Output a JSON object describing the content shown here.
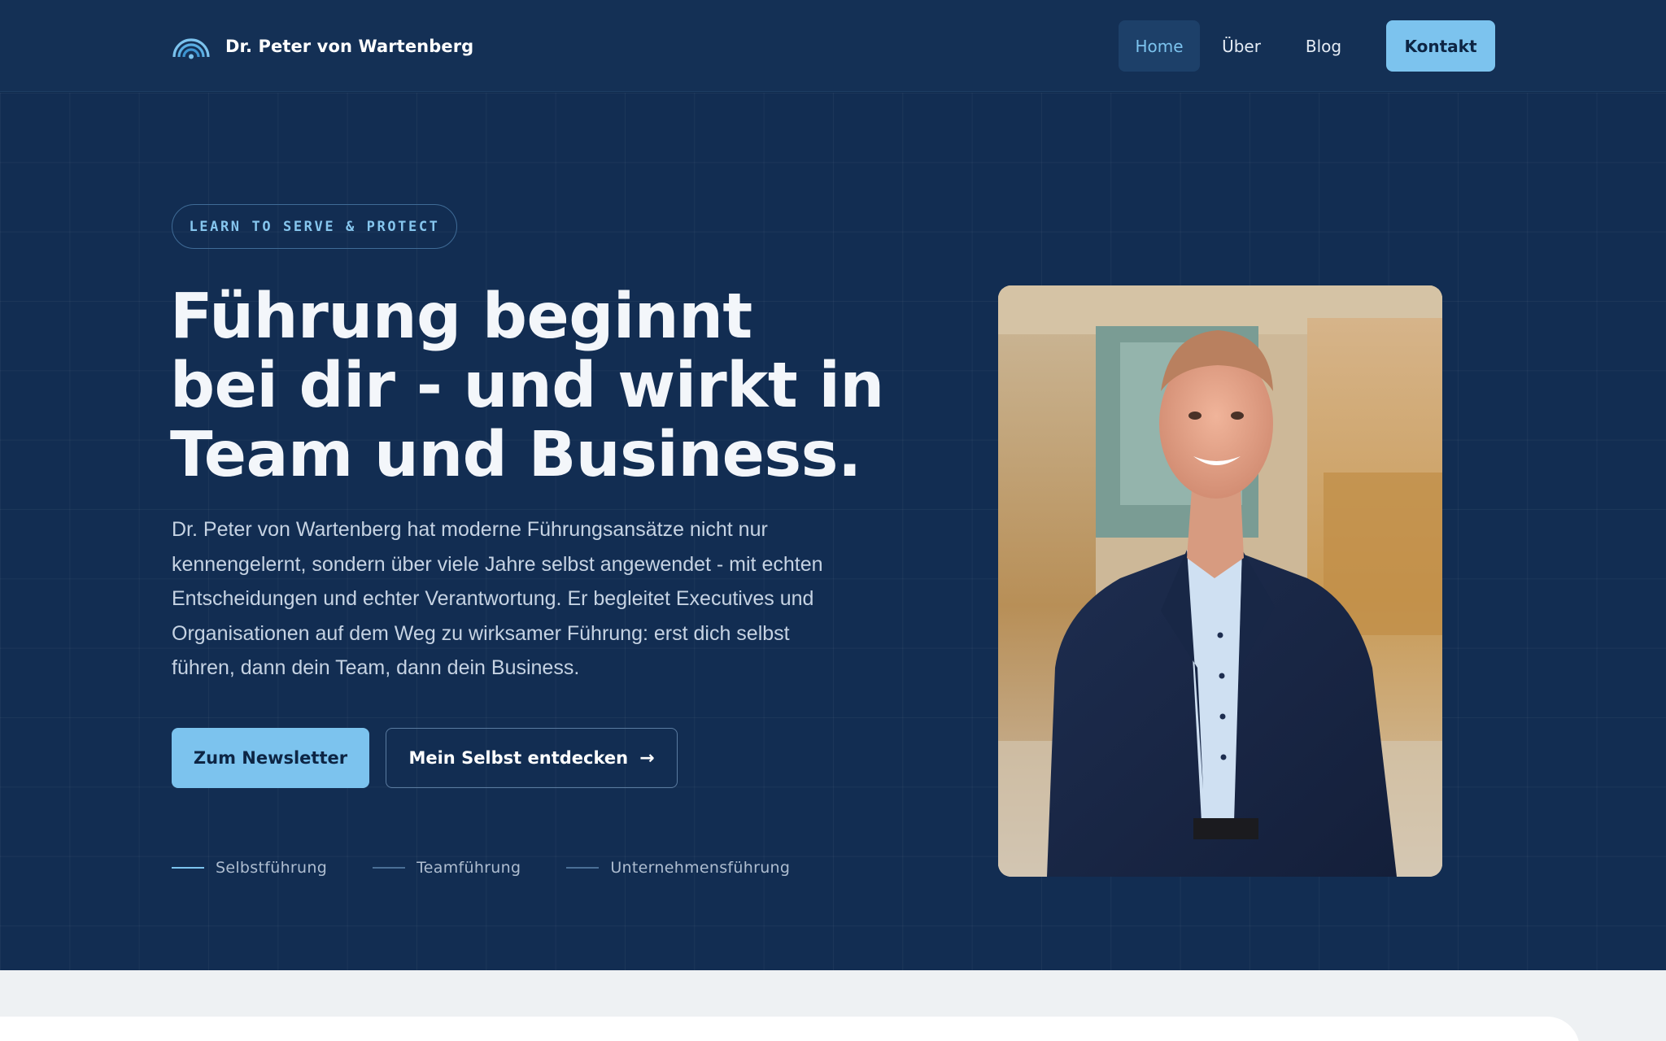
{
  "header": {
    "brand_name": "Dr. Peter von Wartenberg",
    "logo_icon": "rainbow-arc-logo-icon",
    "nav": [
      {
        "label": "Home",
        "active": true
      },
      {
        "label": "Über",
        "active": false
      },
      {
        "label": "Blog",
        "active": false
      }
    ],
    "cta_label": "Kontakt"
  },
  "hero": {
    "badge": "LEARN TO SERVE & PROTECT",
    "headline_lines": [
      "Führung beginnt",
      "bei dir - und wirkt in",
      "Team und Business."
    ],
    "intro": "Dr. Peter von Wartenberg hat moderne Führungsansätze nicht nur kennengelernt, sondern über viele Jahre selbst angewendet - mit echten Entscheidungen und echter Verantwortung. Er begleitet Executives und Organisationen auf dem Weg zu wirksamer Führung: erst dich selbst führen, dann dein Team, dann dein Business.",
    "primary_button": "Zum Newsletter",
    "secondary_button": "Mein Selbst entdecken",
    "secondary_button_icon": "arrow-right-icon",
    "pillars": [
      {
        "label": "Selbstführung",
        "active": true
      },
      {
        "label": "Teamführung",
        "active": false
      },
      {
        "label": "Unternehmensführung",
        "active": false
      }
    ]
  },
  "colors": {
    "header_bg": "#143055",
    "hero_bg": "#122d52",
    "accent": "#7cc3ee",
    "text_primary": "#f3f6fa",
    "text_secondary": "#c6d3e3",
    "bottom_bg": "#eef1f3"
  }
}
